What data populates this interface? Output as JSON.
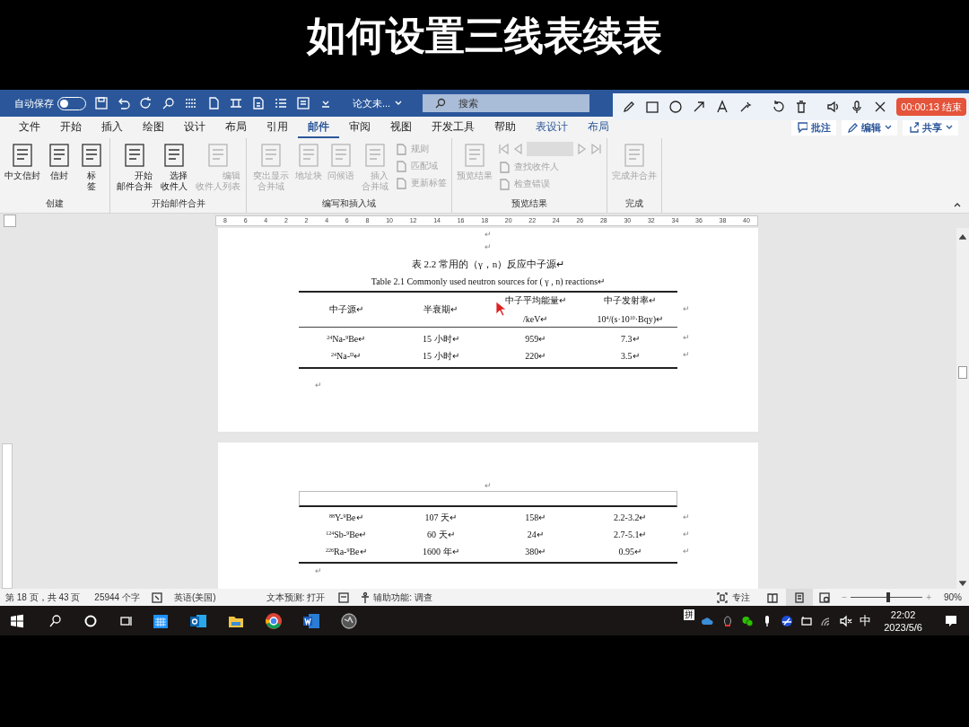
{
  "overlay_title": "如何设置三线表续表",
  "title_bar": {
    "autosave_label": "自动保存",
    "autosave_on": false,
    "doc_title": "论文未...",
    "search_placeholder": "搜索"
  },
  "recorder": {
    "timer": "00:00:13 结束"
  },
  "tabs": [
    {
      "label": "文件",
      "selected": false
    },
    {
      "label": "开始",
      "selected": false
    },
    {
      "label": "插入",
      "selected": false
    },
    {
      "label": "绘图",
      "selected": false
    },
    {
      "label": "设计",
      "selected": false
    },
    {
      "label": "布局",
      "selected": false
    },
    {
      "label": "引用",
      "selected": false
    },
    {
      "label": "邮件",
      "selected": true
    },
    {
      "label": "审阅",
      "selected": false
    },
    {
      "label": "视图",
      "selected": false
    },
    {
      "label": "开发工具",
      "selected": false
    },
    {
      "label": "帮助",
      "selected": false
    },
    {
      "label": "表设计",
      "selected": false
    },
    {
      "label": "布局",
      "selected": false
    }
  ],
  "ribbon_actions": [
    "批注",
    "编辑",
    "共享"
  ],
  "ribbon_groups": [
    {
      "label": "创建",
      "items": [
        {
          "kind": "large",
          "label": "中文信封",
          "disabled": false
        },
        {
          "kind": "large",
          "label": "信封",
          "disabled": false
        },
        {
          "kind": "large",
          "label_lines": [
            "标",
            "签"
          ],
          "disabled": false
        }
      ]
    },
    {
      "label": "开始邮件合并",
      "items": [
        {
          "kind": "large",
          "label_lines": [
            "开始",
            "邮件合并"
          ],
          "disabled": false
        },
        {
          "kind": "large",
          "label_lines": [
            "选择",
            "收件人"
          ],
          "disabled": false
        },
        {
          "kind": "large",
          "label_lines": [
            "编辑",
            "收件人列表"
          ],
          "disabled": true
        }
      ]
    },
    {
      "label": "编写和插入域",
      "items": [
        {
          "kind": "large",
          "label_lines": [
            "突出显示",
            "合并域"
          ],
          "disabled": true
        },
        {
          "kind": "large",
          "label": "地址块",
          "disabled": true
        },
        {
          "kind": "large",
          "label": "问候语",
          "disabled": true
        },
        {
          "kind": "large",
          "label_lines": [
            "插入",
            "合并域"
          ],
          "disabled": true
        },
        {
          "kind": "small",
          "label": "规则",
          "disabled": true
        },
        {
          "kind": "small",
          "label": "匹配域",
          "disabled": true
        },
        {
          "kind": "small",
          "label": "更新标签",
          "disabled": true
        }
      ]
    },
    {
      "label": "预览结果",
      "items": [
        {
          "kind": "large",
          "label": "预览结果",
          "disabled": true
        },
        {
          "kind": "nav",
          "disabled": true
        },
        {
          "kind": "small",
          "label": "查找收件人",
          "disabled": true
        },
        {
          "kind": "small",
          "label": "检查错误",
          "disabled": true
        }
      ]
    },
    {
      "label": "完成",
      "items": [
        {
          "kind": "large",
          "label": "完成并合并",
          "disabled": true
        }
      ]
    }
  ],
  "ruler": [
    "8",
    "6",
    "4",
    "2",
    "2",
    "4",
    "6",
    "8",
    "10",
    "12",
    "14",
    "16",
    "18",
    "20",
    "22",
    "24",
    "26",
    "28",
    "30",
    "32",
    "34",
    "36",
    "38",
    "40"
  ],
  "page_1": {
    "marks_before": [
      "↵",
      "↵"
    ],
    "caption_cn": "表 2.2 常用的（γ，n）反应中子源↵",
    "caption_en": "Table 2.1 Commonly used neutron sources for ( γ , n) reactions↵",
    "header": [
      [
        "中子源↵"
      ],
      [
        "半衰期↵"
      ],
      [
        "中子平均能量↵",
        "/keV↵"
      ],
      [
        "中子发射率↵",
        "10$^{4}$/(s·10$^{10}$·Bqy)↵"
      ]
    ],
    "rows": [
      [
        "$^{24}$Na-$^{9}$Be↵",
        "15 小时↵",
        "959↵",
        "7.3↵"
      ],
      [
        "$^{24}$Na-$^{D}$↵",
        "15 小时↵",
        "220↵",
        "3.5↵"
      ]
    ],
    "row_end_mark": "↵",
    "mark_after": "↵"
  },
  "page_2": {
    "mark_before": "↵",
    "rows": [
      [
        "$^{88}$Y-$^{9}$Be↵",
        "107 天↵",
        "158↵",
        "2.2-3.2↵"
      ],
      [
        "$^{124}$Sb-$^{9}$Be↵",
        "60 天↵",
        "24↵",
        "2.7-5.1↵"
      ],
      [
        "$^{226}$Ra-$^{9}$Be↵",
        "1600 年↵",
        "380↵",
        "0.95↵"
      ]
    ],
    "row_end_mark": "↵",
    "mark_after": "↵"
  },
  "status_bar": {
    "page": "第 18 页，共 43 页",
    "words": "25944 个字",
    "language": "英语(美国)",
    "text_prediction": "文本预测: 打开",
    "accessibility": "辅助功能: 调查",
    "focus": "专注",
    "zoom_out": "−",
    "zoom_slider": {
      "level": 0.52
    },
    "zoom_in": "+",
    "zoom": "90%"
  },
  "taskbar": {
    "ime_mode": "拼",
    "language": "中",
    "time": "22:02",
    "date": "2023/5/6"
  }
}
